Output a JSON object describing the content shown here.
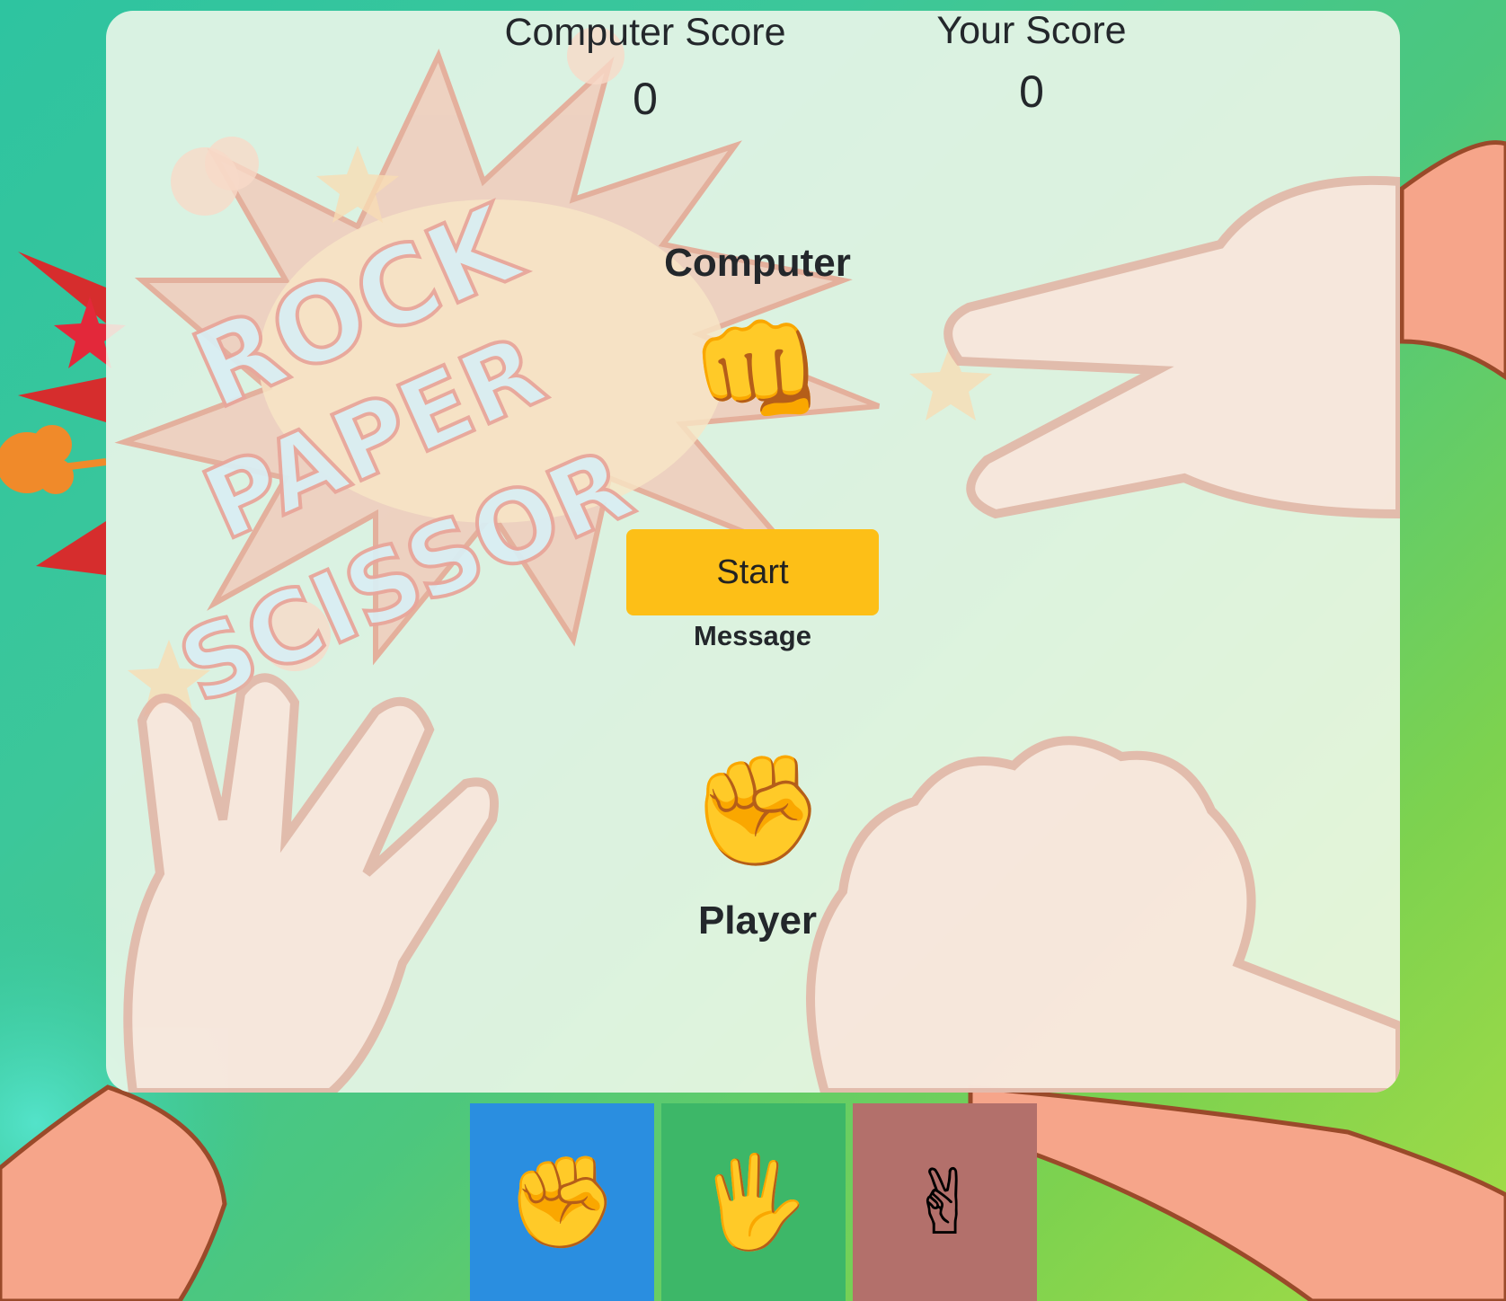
{
  "scores": {
    "computer_label": "Computer Score",
    "computer_value": "0",
    "player_label": "Your Score",
    "player_value": "0"
  },
  "computer": {
    "label": "Computer",
    "emoji": "👊"
  },
  "controls": {
    "start_label": "Start",
    "message": "Message"
  },
  "player": {
    "label": "Player",
    "emoji": "✊"
  },
  "choices": [
    {
      "name": "rock",
      "emoji": "✊",
      "color": "#2a8ee0"
    },
    {
      "name": "paper",
      "emoji": "🖐",
      "color": "#3db768"
    },
    {
      "name": "scissors",
      "emoji": "✌",
      "color": "#b3706b"
    }
  ],
  "background": {
    "logo_words": [
      "ROCK",
      "PAPER",
      "SCISSOR"
    ]
  }
}
